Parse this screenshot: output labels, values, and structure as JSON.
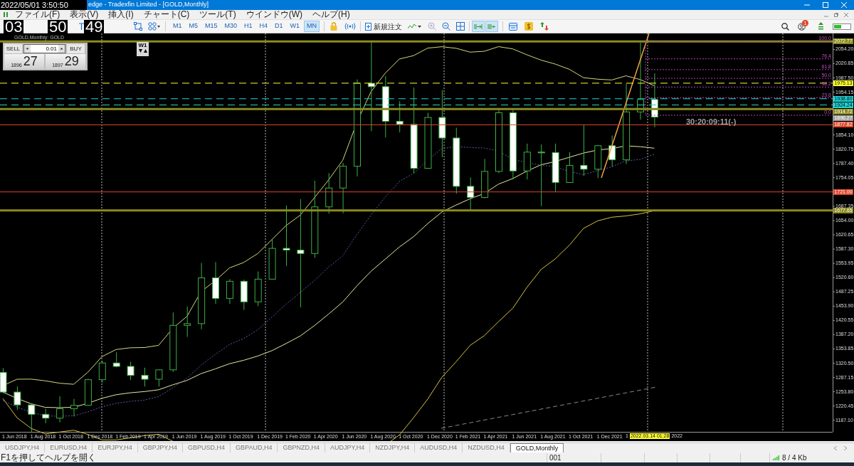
{
  "overlay_clock": {
    "datetime": "2022/05/01 3:50:50",
    "big_time": [
      "03",
      "50",
      "49"
    ]
  },
  "window": {
    "title": "edge - Tradexfin Limited - [GOLD,Monthly]"
  },
  "menu": [
    "ファイル(F)",
    "表示(V)",
    "挿入(I)",
    "チャート(C)",
    "ツール(T)",
    "ウインドウ(W)",
    "ヘルプ(H)"
  ],
  "toolbar": {
    "timeframes": [
      {
        "label": "M1",
        "selected": false
      },
      {
        "label": "M5",
        "selected": false
      },
      {
        "label": "M15",
        "selected": false
      },
      {
        "label": "M30",
        "selected": false
      },
      {
        "label": "H1",
        "selected": false
      },
      {
        "label": "H4",
        "selected": false
      },
      {
        "label": "D1",
        "selected": false
      },
      {
        "label": "W1",
        "selected": false
      },
      {
        "label": "MN",
        "selected": true
      }
    ],
    "new_order": "新規注文",
    "notification_count": "1"
  },
  "chart": {
    "title": "GOLD,Monthly: GOLD",
    "trade_panel": {
      "sell": "SELL",
      "buy": "BUY",
      "lot": "0.01",
      "bid_small": "1896",
      "bid_big": "27",
      "ask_small": "1897",
      "ask_big": "29"
    },
    "period_box": "W1",
    "countdown": "30:20:09:11(-)",
    "price_axis": [
      "2054.20",
      "2020.85",
      "1987.50",
      "1954.15",
      "1854.10",
      "1820.75",
      "1787.40",
      "1754.05",
      "1687.35",
      "1654.00",
      "1620.65",
      "1587.30",
      "1553.95",
      "1520.60",
      "1487.25",
      "1453.90",
      "1420.55",
      "1387.20",
      "1353.85",
      "1320.50",
      "1287.15",
      "1253.80",
      "1220.45",
      "1187.10"
    ],
    "price_tags": [
      {
        "text": "2072.77",
        "color": "#8b8b1e",
        "kind": "thick"
      },
      {
        "text": "1975.13",
        "color": "#ffff33",
        "kind": "dashed"
      },
      {
        "text": "1938.80",
        "color": "#22d3d3",
        "kind": "dashed"
      },
      {
        "text": "1924.24",
        "color": "#22d3d3",
        "kind": "dashed"
      },
      {
        "text": "1914.72",
        "color": "#8b8b1e",
        "kind": "thick"
      },
      {
        "text": "1896.27",
        "color": "#a0a0a0",
        "kind": "bid"
      },
      {
        "text": "1877.82",
        "color": "#e0452a",
        "kind": "solid"
      },
      {
        "text": "1721.00",
        "color": "#e0452a",
        "kind": "solid"
      },
      {
        "text": "1677.65",
        "color": "#8b8b1e",
        "kind": "thick"
      }
    ],
    "fib_levels": [
      "100.0",
      "76.4",
      "61.8",
      "50.0",
      "38.2",
      "23.6",
      "0.0"
    ],
    "date_axis": [
      "1 Jun 2018",
      "1 Aug 2018",
      "1 Oct 2018",
      "1 Dec 2018",
      "1 Feb 2019",
      "1 Apr 2019",
      "1 Jun 2019",
      "1 Aug 2019",
      "1 Oct 2019",
      "1 Dec 2019",
      "1 Feb 2020",
      "1 Apr 2020",
      "1 Jun 2020",
      "1 Aug 2020",
      "1 Oct 2020",
      "1 Dec 2020",
      "1 Feb 2021",
      "1 Apr 2021",
      "1 Jun 2021",
      "1 Aug 2021",
      "1 Oct 2021",
      "1 Dec 2021"
    ],
    "date_axis_tail": {
      "before": "1",
      "after": "2022"
    },
    "time_tag": "2022.03.14 01:28"
  },
  "tabs": [
    {
      "label": "USDJPY,H4",
      "selected": false
    },
    {
      "label": "EURUSD,H4",
      "selected": false
    },
    {
      "label": "EURJPY,H4",
      "selected": false
    },
    {
      "label": "GBPJPY,H4",
      "selected": false
    },
    {
      "label": "GBPUSD,H4",
      "selected": false
    },
    {
      "label": "GBPAUD,H4",
      "selected": false
    },
    {
      "label": "GBPNZD,H4",
      "selected": false
    },
    {
      "label": "AUDJPY,H4",
      "selected": false
    },
    {
      "label": "NZDJPY,H4",
      "selected": false
    },
    {
      "label": "AUDUSD,H4",
      "selected": false
    },
    {
      "label": "NZDUSD,H4",
      "selected": false
    },
    {
      "label": "GOLD,Monthly",
      "selected": true
    }
  ],
  "status_bar": {
    "help": "F1を押してヘルプを開く",
    "profile": "001",
    "traffic": "8 / 4 Kb"
  }
}
